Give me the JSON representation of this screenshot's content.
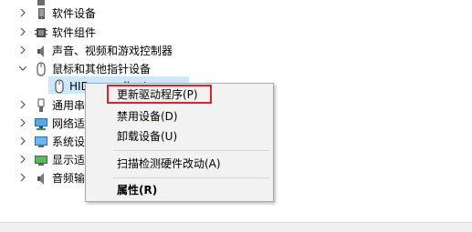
{
  "tree": {
    "items": [
      {
        "label": "软件设备",
        "expanded": false,
        "icon": "software-device-icon"
      },
      {
        "label": "软件组件",
        "expanded": false,
        "icon": "software-component-icon"
      },
      {
        "label": "声音、视频和游戏控制器",
        "expanded": false,
        "icon": "speaker-icon"
      },
      {
        "label": "鼠标和其他指针设备",
        "expanded": true,
        "icon": "mouse-icon"
      },
      {
        "label": "HID-compliant mouse",
        "child": true,
        "selected": true,
        "icon": "mouse-icon"
      },
      {
        "label": "通用串",
        "expanded": false,
        "icon": "usb-icon"
      },
      {
        "label": "网络适",
        "expanded": false,
        "icon": "network-icon"
      },
      {
        "label": "系统设",
        "expanded": false,
        "icon": "system-device-icon"
      },
      {
        "label": "显示适",
        "expanded": false,
        "icon": "display-adapter-icon"
      },
      {
        "label": "音频输",
        "expanded": false,
        "icon": "audio-io-icon"
      }
    ]
  },
  "context_menu": {
    "update_driver": "更新驱动程序(P)",
    "disable_device": "禁用设备(D)",
    "uninstall_device": "卸载设备(U)",
    "scan_hardware": "扫描检测硬件改动(A)",
    "properties": "属性(R)"
  },
  "colors": {
    "highlight_box": "#e0202a",
    "selection": "#cce8ff"
  }
}
